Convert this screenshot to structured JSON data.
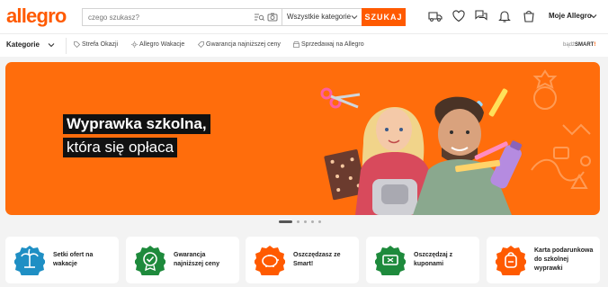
{
  "brand": {
    "logo_text": "allegro",
    "accent": "#ff5a00"
  },
  "search": {
    "placeholder": "czego szukasz?",
    "category_selected": "Wszystkie kategorie",
    "button_label": "SZUKAJ",
    "icons": [
      "list-search-icon",
      "camera-icon"
    ]
  },
  "header": {
    "icons": [
      "delivery-truck-icon",
      "heart-icon",
      "chat-icon",
      "bell-icon",
      "basket-icon"
    ],
    "account_label": "Moje Allegro"
  },
  "nav": {
    "categories_label": "Kategorie",
    "links": [
      {
        "label": "Strefa Okazji",
        "icon": "tag-icon"
      },
      {
        "label": "Allegro Wakacje",
        "icon": "sun-icon"
      },
      {
        "label": "Gwarancja najniższej ceny",
        "icon": "price-tag-icon"
      },
      {
        "label": "Sprzedawaj na Allegro",
        "icon": "store-icon"
      }
    ],
    "smart_badge": {
      "prefix": "bądź",
      "brand": "SMART",
      "mark": "!"
    }
  },
  "hero": {
    "title": "Wyprawka szkolna,",
    "subtitle": "która się opłaca",
    "background": "#ff6d0c",
    "slides_total": 5,
    "active_slide": 1
  },
  "cards": [
    {
      "label": "Setki ofert na wakacje",
      "icon": "palm-tree-icon",
      "color": "#1f8fc4"
    },
    {
      "label": "Gwarancja najniższej ceny",
      "icon": "check-badge-icon",
      "color": "#1e8a3c"
    },
    {
      "label": "Oszczędzasz ze Smart!",
      "icon": "piggy-bank-icon",
      "color": "#ff5a00"
    },
    {
      "label": "Oszczędzaj z kuponami",
      "icon": "coupon-icon",
      "color": "#1e8a3c"
    },
    {
      "label": "Karta podarunkowa do szkolnej wyprawki",
      "icon": "backpack-icon",
      "color": "#ff5a00"
    }
  ]
}
